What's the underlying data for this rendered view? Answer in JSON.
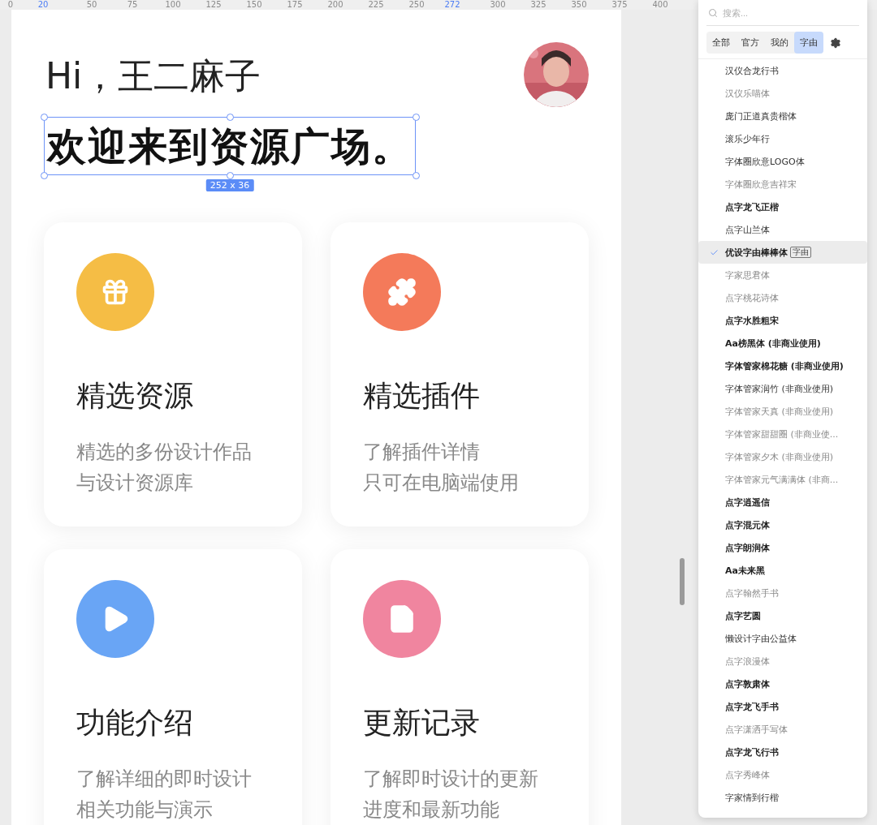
{
  "ruler": {
    "ticks": [
      {
        "label": "0",
        "highlighted": false
      },
      {
        "label": "20",
        "highlighted": true
      },
      {
        "label": "50",
        "highlighted": false
      },
      {
        "label": "75",
        "highlighted": false
      },
      {
        "label": "100",
        "highlighted": false
      },
      {
        "label": "125",
        "highlighted": false
      },
      {
        "label": "150",
        "highlighted": false
      },
      {
        "label": "175",
        "highlighted": false
      },
      {
        "label": "200",
        "highlighted": false
      },
      {
        "label": "225",
        "highlighted": false
      },
      {
        "label": "250",
        "highlighted": false
      },
      {
        "label": "272",
        "highlighted": true
      },
      {
        "label": "300",
        "highlighted": false
      },
      {
        "label": "325",
        "highlighted": false
      },
      {
        "label": "350",
        "highlighted": false
      },
      {
        "label": "375",
        "highlighted": false
      },
      {
        "label": "400",
        "highlighted": false
      }
    ]
  },
  "artboard": {
    "greeting": "Hi，王二麻子",
    "headline": "欢迎来到资源广场。",
    "headline_selected": true,
    "size_badge": "252 x 36",
    "cards": [
      {
        "kind": "gift",
        "color": "#f5bd45",
        "title": "精选资源",
        "lines": [
          "精选的多份设计作品",
          "与设计资源库"
        ]
      },
      {
        "kind": "puzzle",
        "color": "#f47a5a",
        "title": "精选插件",
        "lines": [
          "了解插件详情",
          "只可在电脑端使用"
        ]
      },
      {
        "kind": "play",
        "color": "#69a5f5",
        "title": "功能介绍",
        "lines": [
          "了解详细的即时设计",
          "相关功能与演示"
        ]
      },
      {
        "kind": "file",
        "color": "#f0859f",
        "title": "更新记录",
        "lines": [
          "了解即时设计的更新",
          "进度和最新功能"
        ]
      }
    ]
  },
  "font_panel": {
    "search": {
      "placeholder": "搜索..."
    },
    "tabs": [
      {
        "label": "全部",
        "selected": false
      },
      {
        "label": "官方",
        "selected": false
      },
      {
        "label": "我的",
        "selected": false
      },
      {
        "label": "字由",
        "selected": true
      }
    ],
    "fonts": [
      {
        "name": "汉仪合龙行书",
        "bold": false,
        "dimmed": false,
        "selected": false
      },
      {
        "name": "汉仪乐喵体",
        "bold": false,
        "dimmed": true,
        "selected": false
      },
      {
        "name": "庞门正道真贵楷体",
        "bold": false,
        "dimmed": false,
        "selected": false
      },
      {
        "name": "滚乐少年行",
        "bold": false,
        "dimmed": false,
        "selected": false
      },
      {
        "name": "字体圈欣意LOGO体",
        "bold": false,
        "dimmed": false,
        "selected": false
      },
      {
        "name": "字体圈欣意吉祥宋",
        "bold": false,
        "dimmed": true,
        "selected": false
      },
      {
        "name": "点字龙飞正楷",
        "bold": true,
        "dimmed": false,
        "selected": false
      },
      {
        "name": "点字山兰体",
        "bold": false,
        "dimmed": false,
        "selected": false
      },
      {
        "name": "优设字由棒棒体",
        "bold": true,
        "dimmed": false,
        "selected": true,
        "tag": "字由"
      },
      {
        "name": "字家思君体",
        "bold": false,
        "dimmed": true,
        "selected": false
      },
      {
        "name": "点字桃花诗体",
        "bold": false,
        "dimmed": true,
        "selected": false
      },
      {
        "name": "点字水胜粗宋",
        "bold": true,
        "dimmed": false,
        "selected": false
      },
      {
        "name": "Aa榜黑体 (非商业使用)",
        "bold": true,
        "dimmed": false,
        "selected": false
      },
      {
        "name": "字体管家棉花糖 (非商业使用)",
        "bold": true,
        "dimmed": false,
        "selected": false
      },
      {
        "name": "字体管家润竹 (非商业使用)",
        "bold": false,
        "dimmed": false,
        "selected": false
      },
      {
        "name": "字体管家天真 (非商业使用)",
        "bold": false,
        "dimmed": true,
        "selected": false
      },
      {
        "name": "字体管家甜甜圈 (非商业使...",
        "bold": false,
        "dimmed": true,
        "selected": false
      },
      {
        "name": "字体管家夕木 (非商业使用)",
        "bold": false,
        "dimmed": true,
        "selected": false
      },
      {
        "name": "字体管家元气满满体 (非商...",
        "bold": false,
        "dimmed": true,
        "selected": false
      },
      {
        "name": "点字逍遥信",
        "bold": true,
        "dimmed": false,
        "selected": false
      },
      {
        "name": "点字混元体",
        "bold": true,
        "dimmed": false,
        "selected": false
      },
      {
        "name": "点字朗润体",
        "bold": true,
        "dimmed": false,
        "selected": false
      },
      {
        "name": "Aa未来黑",
        "bold": true,
        "dimmed": false,
        "selected": false
      },
      {
        "name": "点字翰然手书",
        "bold": false,
        "dimmed": true,
        "selected": false
      },
      {
        "name": "点字艺圆",
        "bold": true,
        "dimmed": false,
        "selected": false
      },
      {
        "name": "懒设计字由公益体",
        "bold": false,
        "dimmed": false,
        "selected": false
      },
      {
        "name": "点字浪漫体",
        "bold": false,
        "dimmed": true,
        "selected": false
      },
      {
        "name": "点字敦肃体",
        "bold": true,
        "dimmed": false,
        "selected": false
      },
      {
        "name": "点字龙飞手书",
        "bold": true,
        "dimmed": false,
        "selected": false
      },
      {
        "name": "点字潇洒手写体",
        "bold": false,
        "dimmed": true,
        "selected": false
      },
      {
        "name": "点字龙飞行书",
        "bold": true,
        "dimmed": false,
        "selected": false
      },
      {
        "name": "点字秀峰体",
        "bold": false,
        "dimmed": true,
        "selected": false
      },
      {
        "name": "字家情到行楷",
        "bold": false,
        "dimmed": false,
        "selected": false
      }
    ]
  }
}
